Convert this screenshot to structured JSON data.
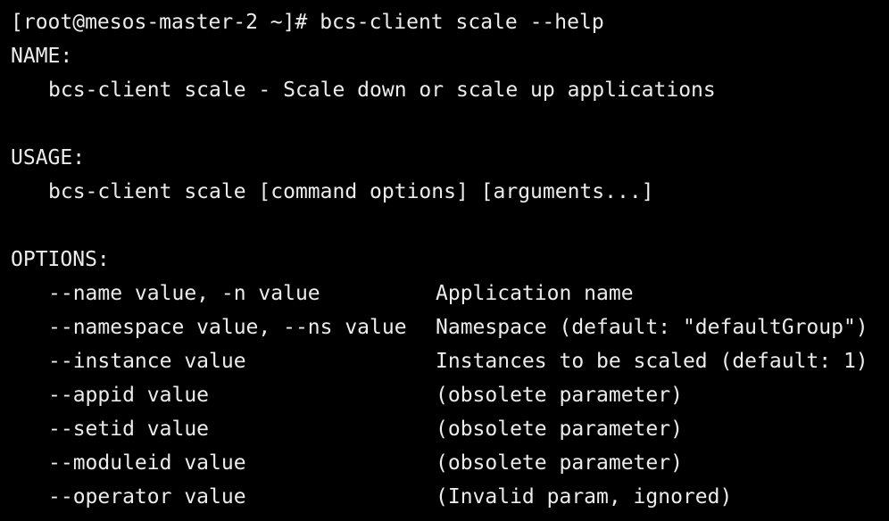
{
  "terminal": {
    "prompt": "[root@mesos-master-2 ~]# ",
    "command": "bcs-client scale --help",
    "name_header": "NAME:",
    "name_text": "bcs-client scale - Scale down or scale up applications",
    "usage_header": "USAGE:",
    "usage_text": "bcs-client scale [command options] [arguments...]",
    "options_header": "OPTIONS:",
    "options": [
      {
        "flag": "--name value, -n value",
        "description": "Application name"
      },
      {
        "flag": "--namespace value, --ns value",
        "description": "Namespace (default: \"defaultGroup\")"
      },
      {
        "flag": "--instance value",
        "description": "Instances to be scaled (default: 1)"
      },
      {
        "flag": "--appid value",
        "description": "(obsolete parameter)"
      },
      {
        "flag": "--setid value",
        "description": "(obsolete parameter)"
      },
      {
        "flag": "--moduleid value",
        "description": "(obsolete parameter)"
      },
      {
        "flag": "--operator value",
        "description": "(Invalid param, ignored)"
      }
    ]
  },
  "colors": {
    "background": "#000000",
    "text": "#ececec"
  }
}
